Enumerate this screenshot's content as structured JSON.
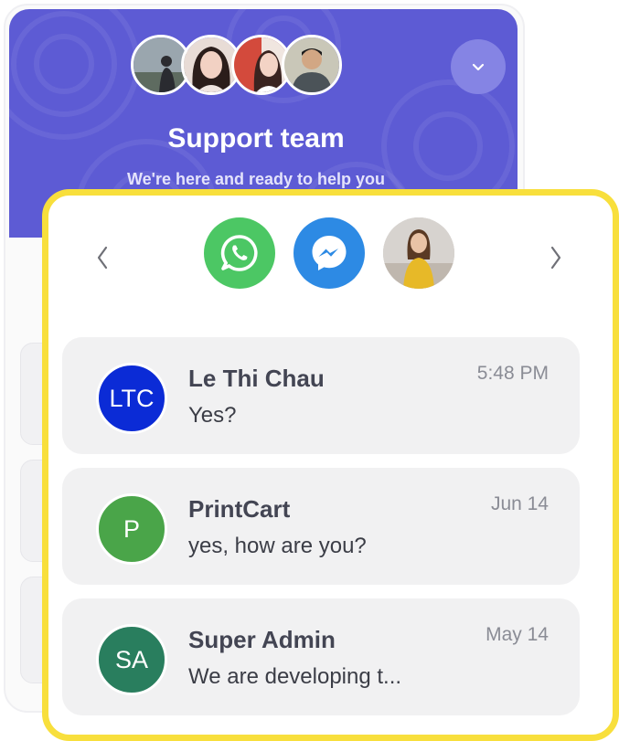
{
  "header": {
    "title": "Support team",
    "subtitle": "We're here and ready to help you",
    "collapse_icon": "chevron-down-icon",
    "accent_color": "#5d5bd4"
  },
  "channels": {
    "prev_icon": "chevron-left-icon",
    "next_icon": "chevron-right-icon",
    "items": [
      {
        "icon": "whatsapp-icon",
        "color": "#4cc764"
      },
      {
        "icon": "messenger-icon",
        "color": "#2d8ae4"
      },
      {
        "icon": "agent-photo",
        "color": "#c7c2bd"
      }
    ]
  },
  "conversations": [
    {
      "initials": "LTC",
      "name": "Le Thi Chau",
      "message": "Yes?",
      "time": "5:48 PM",
      "color": "#0b2bd6"
    },
    {
      "initials": "P",
      "name": "PrintCart",
      "message": "yes, how are you?",
      "time": "Jun 14",
      "color": "#4aa549"
    },
    {
      "initials": "SA",
      "name": "Super Admin",
      "message": "We are developing t...",
      "time": "May 14",
      "color": "#297e5e"
    }
  ],
  "highlight_color": "#f8df3c"
}
